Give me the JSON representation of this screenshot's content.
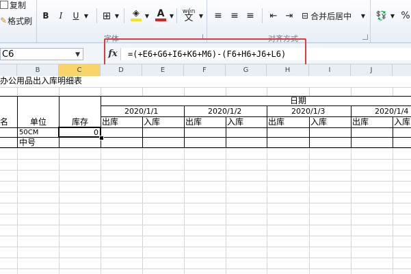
{
  "ribbon": {
    "clipboard": {
      "copy_label": "复制",
      "format_painter_label": "格式刷"
    },
    "font": {
      "group_label": "字体",
      "bold": "B",
      "italic": "I",
      "underline": "U",
      "wen_label": "wén"
    },
    "alignment": {
      "group_label": "对齐方式",
      "merge_center_label": "合并后居中"
    },
    "number": {
      "percent": "%"
    },
    "colors": {
      "fill": "#f6e31e",
      "font_color": "#e02020"
    }
  },
  "formula_bar": {
    "name_box": "C6",
    "fx_label": "fx",
    "formula": "=(+E6+G6+I6+K6+M6)-(F6+H6+J6+L6)",
    "highlight_color": "#e03b3b"
  },
  "columns": [
    "B",
    "C",
    "D",
    "E",
    "F",
    "G",
    "H",
    "I",
    "J"
  ],
  "sheet": {
    "title": "办公用品出入库明细表",
    "date_header": "日期",
    "dates": [
      "2020/1/1",
      "2020/1/2",
      "2020/1/3",
      "2020/1/4"
    ],
    "out_label": "出库",
    "in_label": "入库",
    "name_partial": "名",
    "unit_header": "单位",
    "stock_header": "库存",
    "row1_unit": "50CM",
    "row1_stock": "0",
    "row2_unit": "中号"
  }
}
